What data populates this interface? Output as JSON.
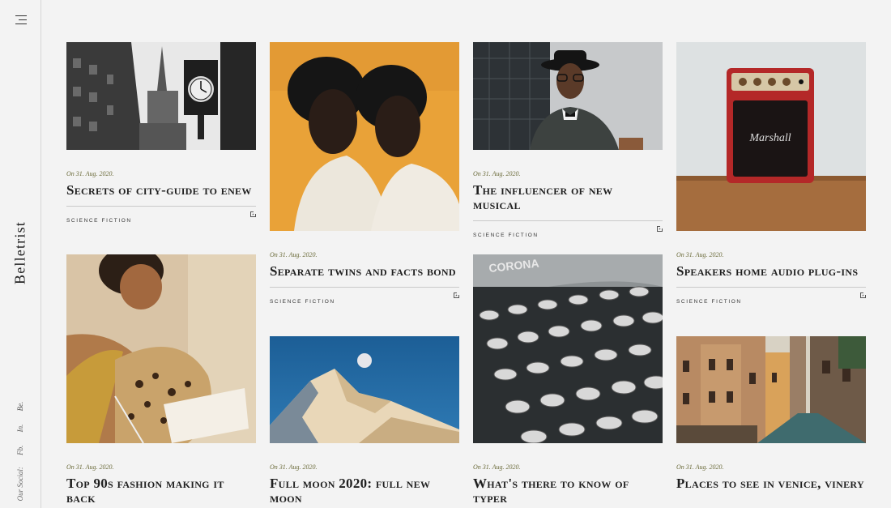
{
  "brand": "Belletrist",
  "social": {
    "label": "Our Social:",
    "links": [
      "Fb.",
      "In.",
      "Be."
    ]
  },
  "posts": [
    {
      "date": "On 31. Aug. 2020.",
      "title": "Secrets of city-guide to enew",
      "category": "Science Fiction"
    },
    {
      "date": "On 31. Aug. 2020.",
      "title": "Separate twins and facts bond",
      "category": "Science Fiction"
    },
    {
      "date": "On 31. Aug. 2020.",
      "title": "The influencer of new musical",
      "category": "Science Fiction"
    },
    {
      "date": "On 31. Aug. 2020.",
      "title": "Speakers home audio plug-ins",
      "category": "Science Fiction"
    },
    {
      "date": "On 31. Aug. 2020.",
      "title": "Top 90s fashion making it back"
    },
    {
      "date": "On 31. Aug. 2020.",
      "title": "Full moon 2020: full new moon"
    },
    {
      "date": "On 31. Aug. 2020.",
      "title": "What's there to know of typer"
    },
    {
      "date": "On 31. Aug. 2020.",
      "title": "Places to see in venice, vinery"
    }
  ]
}
